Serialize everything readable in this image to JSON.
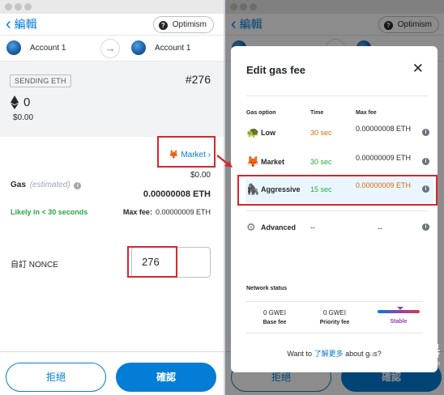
{
  "left": {
    "back_label": "編輯",
    "network": "Optimism",
    "from_account": "Account 1",
    "to_account": "Account 1",
    "sending_badge": "SENDING ETH",
    "tx_number": "#276",
    "eth_amount": "0",
    "fiat_amount": "$0.00",
    "market_label": "Market",
    "gas_fiat": "$0.00",
    "gas_label": "Gas",
    "gas_estimated": "(estimated)",
    "gas_eth": "0.00000008 ETH",
    "likely_label": "Likely in < 30 seconds",
    "max_fee_label": "Max fee:",
    "max_fee_value": "0.00000009 ETH",
    "nonce_label": "自訂 NONCE",
    "nonce_value": "276",
    "reject_label": "拒絕",
    "confirm_label": "確認"
  },
  "right": {
    "back_label": "編輯",
    "network": "Optimism",
    "modal_title": "Edit gas fee",
    "col_option": "Gas option",
    "col_time": "Time",
    "col_maxfee": "Max fee",
    "options": [
      {
        "emoji": "🐢",
        "name": "Low",
        "time": "30 sec",
        "fee": "0.00000008 ETH"
      },
      {
        "emoji": "🦊",
        "name": "Market",
        "time": "30 sec",
        "fee": "0.00000009 ETH"
      },
      {
        "emoji": "🦍",
        "name": "Aggressive",
        "time": "15 sec",
        "fee": "0.00000009 ETH"
      },
      {
        "emoji": "⚙",
        "name": "Advanced",
        "time": "--",
        "fee": "--"
      }
    ],
    "network_status_label": "Network status",
    "base_fee_value": "0 GWEI",
    "base_fee_label": "Base fee",
    "priority_fee_value": "0 GWEI",
    "priority_fee_label": "Priority fee",
    "stable_label": "Stable",
    "want_to_prefix": "Want to ",
    "want_to_link": "了解更多",
    "want_to_suffix": " about gas?",
    "reject_label": "拒絕",
    "confirm_label": "確認"
  },
  "watermark": {
    "main": "路由器",
    "sub": "luyouqi.com"
  },
  "colors": {
    "accent": "#037dd6",
    "highlight": "#d7262d",
    "green": "#28a745",
    "orange": "#d46b08"
  }
}
